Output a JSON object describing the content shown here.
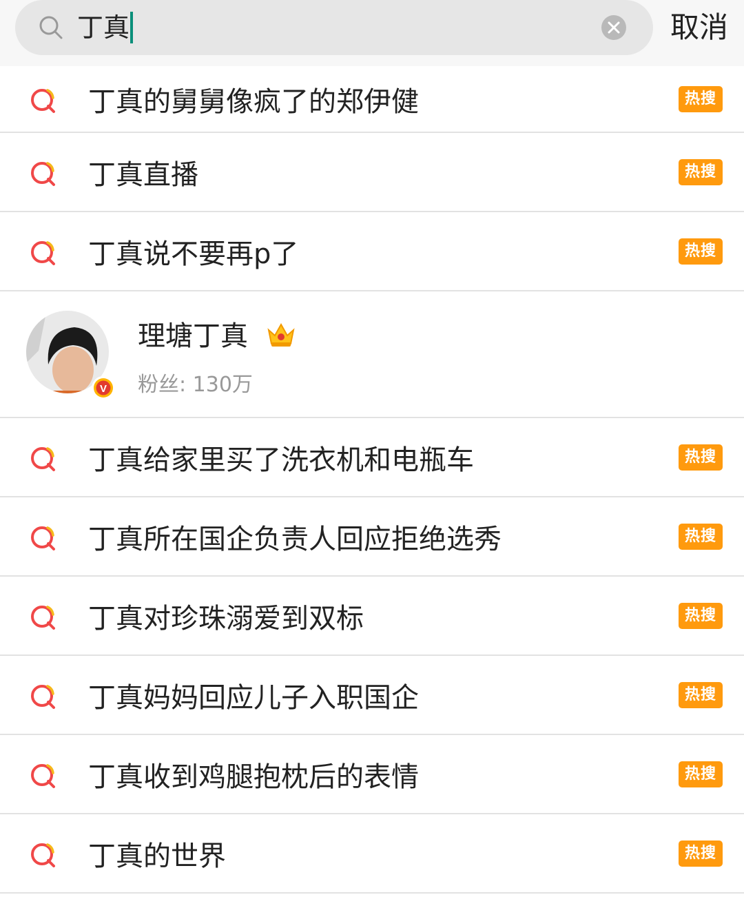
{
  "search": {
    "query": "丁真",
    "cancel_label": "取消"
  },
  "suggestions_top": [
    {
      "text": "丁真的舅舅像疯了的郑伊健",
      "badge": "热搜"
    },
    {
      "text": "丁真直播",
      "badge": "热搜"
    },
    {
      "text": "丁真说不要再p了",
      "badge": "热搜"
    }
  ],
  "user_result": {
    "name": "理塘丁真",
    "fans": "粉丝: 130万",
    "verified_badge": "V"
  },
  "suggestions_bottom": [
    {
      "text": "丁真给家里买了洗衣机和电瓶车",
      "badge": "热搜"
    },
    {
      "text": "丁真所在国企负责人回应拒绝选秀",
      "badge": "热搜"
    },
    {
      "text": "丁真对珍珠溺爱到双标",
      "badge": "热搜"
    },
    {
      "text": "丁真妈妈回应儿子入职国企",
      "badge": "热搜"
    },
    {
      "text": "丁真收到鸡腿抱枕后的表情",
      "badge": "热搜"
    },
    {
      "text": "丁真的世界",
      "badge": "热搜"
    }
  ],
  "colors": {
    "badge": "#ff9a0e",
    "icon_red": "#f04848",
    "icon_yellow": "#f6b81a",
    "caret": "#0a8f7a"
  }
}
